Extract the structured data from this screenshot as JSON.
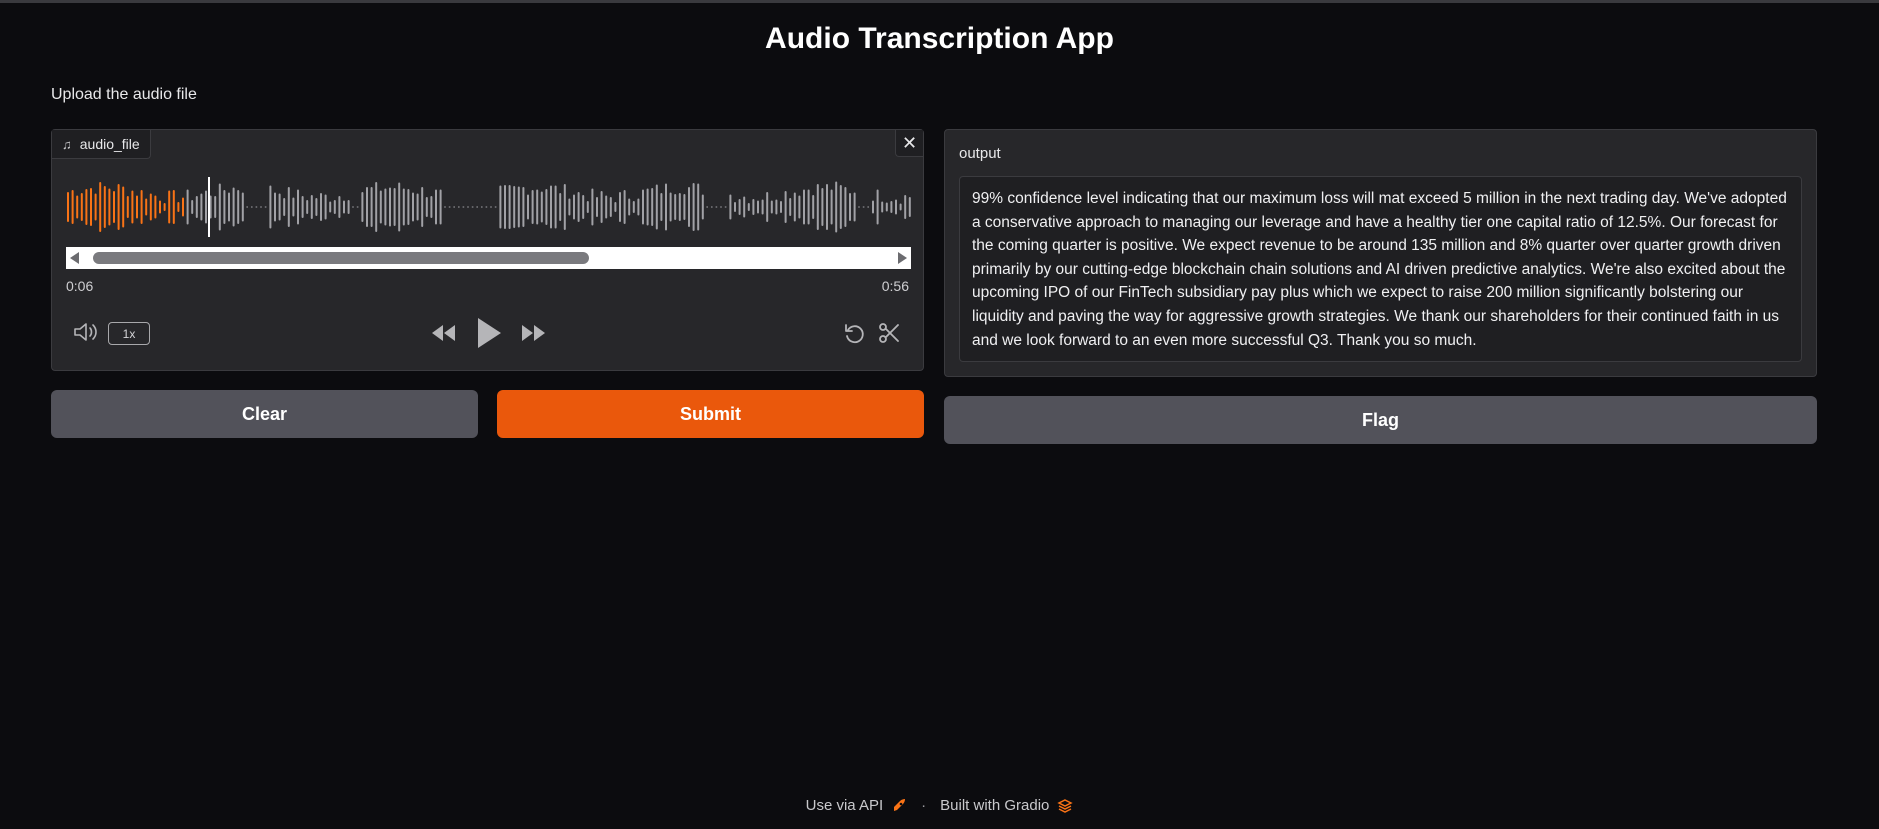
{
  "app": {
    "title": "Audio Transcription App"
  },
  "input": {
    "description": "Upload the audio file",
    "label": "audio_file",
    "label_icon": "music-note-icon",
    "clear_icon": "close-icon",
    "current_time": "0:06",
    "duration": "0:56",
    "playback_progress": 0.107,
    "playback_rate": "1x",
    "controls": [
      "volume-icon",
      "rewind-icon",
      "play-icon",
      "fast-forward-icon",
      "undo-icon",
      "scissors-icon"
    ],
    "waveform_played_color": "#f97316",
    "waveform_unplayed_color": "#a1a1a6"
  },
  "output": {
    "label": "output",
    "text": " 99% confidence level indicating that our maximum loss will mat exceed 5 million in the next trading day. We've adopted a conservative approach to managing our leverage and have a healthy tier one capital ratio of 12.5%. Our forecast for the coming quarter is positive. We expect revenue to be around 135 million and 8% quarter over quarter growth driven primarily by our cutting-edge blockchain chain solutions and AI driven predictive analytics. We're also excited about the upcoming IPO of our FinTech subsidiary pay plus which we expect to raise 200 million significantly bolstering our liquidity and paving the way for aggressive growth strategies. We thank our shareholders for their continued faith in us and we look forward to an even more successful Q3. Thank you so much."
  },
  "buttons": {
    "clear": "Clear",
    "submit": "Submit",
    "flag": "Flag",
    "submit_color": "#ea580c"
  },
  "footer": {
    "api": "Use via API",
    "api_icon": "rocket-icon",
    "separator": "·",
    "built": "Built with Gradio",
    "built_icon": "gradio-logo-icon"
  }
}
